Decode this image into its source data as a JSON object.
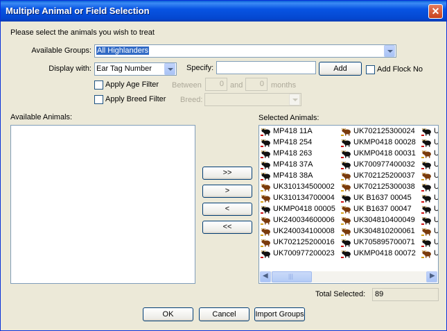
{
  "window": {
    "title": "Multiple Animal or Field Selection"
  },
  "instruction": "Please select the animals you wish to treat",
  "groups": {
    "label": "Available Groups:",
    "value": "All Highlanders"
  },
  "display": {
    "label": "Display with:",
    "value": "Ear Tag Number"
  },
  "specify": {
    "label": "Specify:",
    "value": ""
  },
  "add_label": "Add",
  "add_flock_label": "Add Flock No",
  "age_filter": {
    "label": "Apply Age Filter",
    "between": "Between",
    "from": "0",
    "and": "and",
    "to": "0",
    "months": "months"
  },
  "breed_filter": {
    "label": "Apply Breed Filter",
    "breed": "Breed:",
    "value": ""
  },
  "available_label": "Available Animals:",
  "selected_label": "Selected Animals:",
  "transfer": {
    "all_right": ">>",
    "right": ">",
    "left": "<",
    "all_left": "<<"
  },
  "selected_animals": {
    "col1": [
      "MP418 11A",
      "MP418 254",
      "MP418 263",
      "MP418 37A",
      "MP418 38A",
      "UK310134500002",
      "UK310134700004",
      "UKMP0418 00005",
      "UK240034600006",
      "UK240034100008",
      "UK702125200016",
      "UK700977200023"
    ],
    "col2": [
      "UK702125300024",
      "UKMP0418 00028",
      "UKMP0418 00031",
      "UK700977400032",
      "UK702125200037",
      "UK702125300038",
      "UK B1637 00045",
      "UK B1637 00047",
      "UK304810400049",
      "UK304810200061",
      "UK705895700071",
      "UKMP0418 00072"
    ],
    "col3": [
      "U",
      "U",
      "U",
      "U",
      "U",
      "U",
      "U",
      "U",
      "U",
      "U",
      "U",
      "U"
    ],
    "col1_types": [
      "cow",
      "cow",
      "cow",
      "cow",
      "cow",
      "bull",
      "bull",
      "cow",
      "bull",
      "bull",
      "bull",
      "cow"
    ],
    "col2_types": [
      "bull",
      "cow",
      "cow",
      "cow",
      "bull",
      "bull",
      "cow",
      "bull",
      "bull",
      "bull",
      "cow",
      "cow"
    ],
    "col3_types": [
      "cow",
      "cow",
      "bull",
      "cow",
      "bull",
      "cow",
      "cow",
      "cow",
      "cow",
      "bull",
      "cow",
      "bull"
    ]
  },
  "total": {
    "label": "Total Selected:",
    "value": "89"
  },
  "buttons": {
    "ok": "OK",
    "cancel": "Cancel",
    "import": "Import Groups"
  }
}
